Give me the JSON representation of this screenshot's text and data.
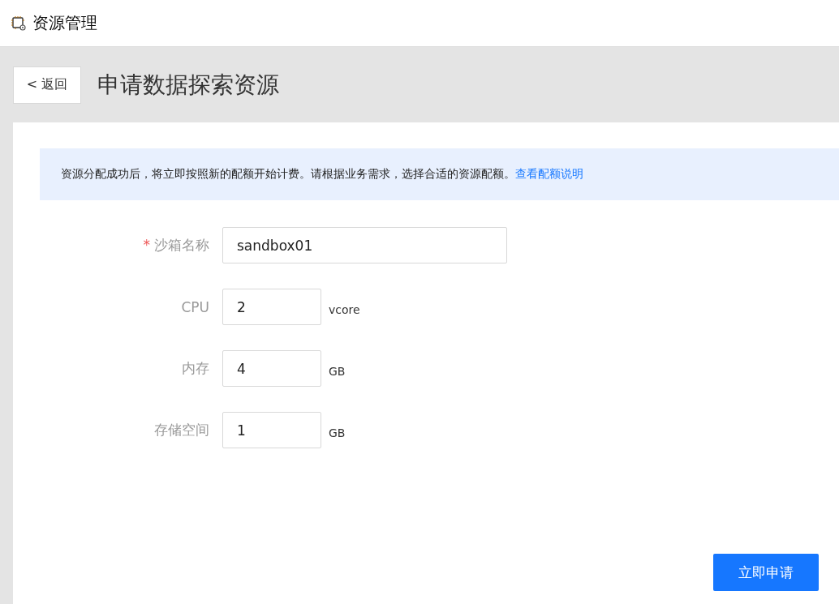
{
  "app_title": "资源管理",
  "back_button": "< 返回",
  "page_title": "申请数据探索资源",
  "notice": {
    "text": "资源分配成功后，将立即按照新的配额开始计费。请根据业务需求，选择合适的资源配额。",
    "link": "查看配额说明"
  },
  "fields": [
    {
      "required_mark": "*",
      "label": "沙箱名称",
      "value": "sandbox01",
      "kind": "wide"
    },
    {
      "label": "CPU",
      "value": "2",
      "unit": "vcore",
      "kind": "narrow"
    },
    {
      "label": "内存",
      "value": "4",
      "unit": "GB",
      "kind": "narrow"
    },
    {
      "label": "存储空间",
      "value": "1",
      "unit": "GB",
      "kind": "narrow"
    }
  ],
  "submit_button": "立即申请"
}
